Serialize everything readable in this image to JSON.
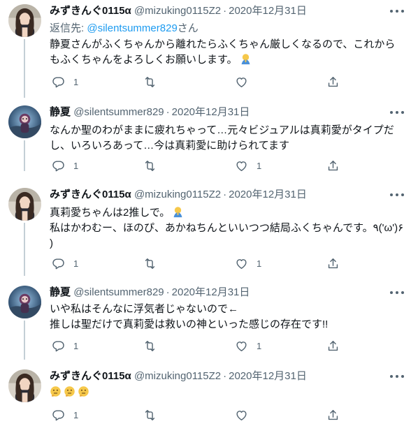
{
  "tweets": [
    {
      "author": "みずきんぐ0115α",
      "handle": "@mizuking0115Z2",
      "date": "2020年12月31日",
      "replying_label": "返信先:",
      "replying_mention": "@silentsummer829",
      "replying_suffix": "さん",
      "lines": [
        "静夏さんがふくちゃんから離れたらふくちゃん厳しくなるので、これから",
        "もふくちゃんをよろしくお願いします。"
      ],
      "reply_count": "1",
      "like_count": ""
    },
    {
      "author": "静夏",
      "handle": "@silentsummer829",
      "date": "2020年12月31日",
      "lines": [
        "なんか聖のわがままに疲れちゃって…元々ビジュアルは真莉愛がタイプだ",
        "し、いろいろあって…今は真莉愛に助けられてます"
      ],
      "reply_count": "1",
      "like_count": "1"
    },
    {
      "author": "みずきんぐ0115α",
      "handle": "@mizuking0115Z2",
      "date": "2020年12月31日",
      "lines": [
        "真莉愛ちゃんは2推しで。",
        "私はかわむー、ほのぴ、あかねちんといいつつ結局ふくちゃんです。٩('ω')۶",
        ")"
      ],
      "reply_count": "1",
      "like_count": "1"
    },
    {
      "author": "静夏",
      "handle": "@silentsummer829",
      "date": "2020年12月31日",
      "lines": [
        "いや私はそんなに浮気者じゃないので←",
        "推しは聖だけで真莉愛は救いの神といった感じの存在です!!"
      ],
      "reply_count": "1",
      "like_count": "1"
    },
    {
      "author": "みずきんぐ0115α",
      "handle": "@mizuking0115Z2",
      "date": "2020年12月31日",
      "lines": [
        ""
      ],
      "reply_count": "1",
      "like_count": ""
    }
  ],
  "icons": {
    "reply": "speech-bubble-icon",
    "retweet": "retweet-arrows-icon",
    "like": "heart-icon",
    "share": "share-upload-icon",
    "more": "three-dots-icon",
    "emoji_pray": "folded-hands-emoji",
    "emoji_think": "thinking-face-emoji"
  },
  "colors": {
    "text": "#0f1419",
    "secondary": "#536471",
    "link": "#1d9bf0",
    "connector": "#c4cfd6"
  }
}
